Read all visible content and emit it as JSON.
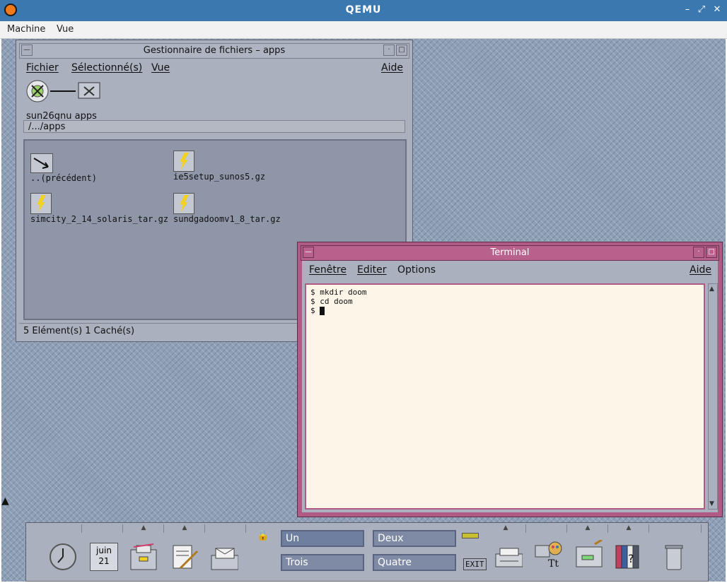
{
  "qemu": {
    "title": "QEMU",
    "controls": [
      "–",
      "⤢",
      "✕"
    ],
    "menu": [
      "Machine",
      "Vue"
    ]
  },
  "file_manager": {
    "title": "Gestionnaire de fichiers – apps",
    "menu": [
      "Fichier",
      "Sélectionné(s)",
      "Vue",
      "Aide"
    ],
    "host_label": "sun26gnu",
    "folder_label": "apps",
    "path": "/.../apps",
    "files": [
      "..(précédent)",
      "ie5setup_sunos5.gz",
      "simcity_2_14_solaris_tar.gz",
      "sundgadoomv1_8_tar.gz"
    ],
    "status": "5 Elément(s) 1 Caché(s)"
  },
  "terminal": {
    "title": "Terminal",
    "menu": [
      "Fenêtre",
      "Editer",
      "Options",
      "Aide"
    ],
    "lines": [
      "$ mkdir doom",
      "$ cd doom",
      "$ "
    ]
  },
  "front_panel": {
    "calendar_month": "juin",
    "calendar_day": "21",
    "workspaces": [
      "Un",
      "Deux",
      "Trois",
      "Quatre"
    ],
    "exit_label": "EXIT",
    "help_label": "?"
  }
}
